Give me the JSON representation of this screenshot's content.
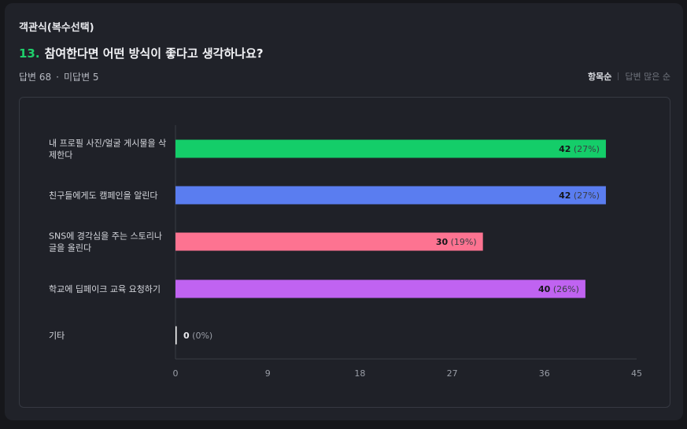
{
  "question": {
    "type_label": "객관식(복수선택)",
    "number": "13.",
    "title": "참여한다면 어떤 방식이 좋다고 생각하나요?",
    "answered": "답변 68",
    "separator": "·",
    "unanswered": "미답변 5"
  },
  "sort": {
    "active": "항목순",
    "inactive": "답변 많은 순"
  },
  "chart_data": {
    "type": "bar",
    "orientation": "horizontal",
    "categories": [
      "내 프로필 사진/얼굴 게시물을 삭제한다",
      "친구들에게도 캠페인을 알린다",
      "SNS에 경각심을 주는 스토리나 글을 올린다",
      "학교에 딥페이크 교육 요청하기",
      "기타"
    ],
    "label_lines": [
      [
        "내 프로필 사진/얼굴 게시물을 삭",
        "제한다"
      ],
      [
        "친구들에게도 캠페인을 알린다"
      ],
      [
        "SNS에 경각심을 주는 스토리나",
        "글을 올린다"
      ],
      [
        "학교에 딥페이크 교육 요청하기"
      ],
      [
        "기타"
      ]
    ],
    "values": [
      42,
      42,
      30,
      40,
      0
    ],
    "percent_labels": [
      "(27%)",
      "(27%)",
      "(19%)",
      "(26%)",
      "(0%)"
    ],
    "colors": [
      "#14cd69",
      "#5a7df0",
      "#fd7391",
      "#c063f1",
      "#ffffff"
    ],
    "xlim": [
      0,
      45
    ],
    "xticks": [
      0,
      9,
      18,
      27,
      36,
      45
    ],
    "grid": false
  }
}
